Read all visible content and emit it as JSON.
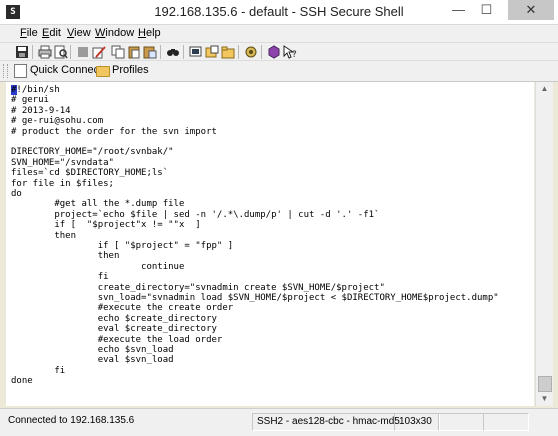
{
  "window": {
    "title": "192.168.135.6 - default - SSH Secure Shell",
    "app_icon_text": "S",
    "minimize_glyph": "—",
    "maximize_glyph": "☐",
    "close_glyph": "✕"
  },
  "menu": {
    "items": [
      {
        "underline": "F",
        "rest": "ile"
      },
      {
        "underline": "E",
        "rest": "dit"
      },
      {
        "underline": "V",
        "rest": "iew"
      },
      {
        "underline": "W",
        "rest": "indow"
      },
      {
        "underline": "H",
        "rest": "elp"
      }
    ]
  },
  "toolbar": {
    "buttons": [
      "save-icon",
      "print-icon",
      "print-preview-icon",
      "blank-icon",
      "settings-icon",
      "copy-icon",
      "paste-icon",
      "paste-special-icon",
      "find-icon",
      "new-terminal-icon",
      "new-file-transfer-icon",
      "profiles-icon",
      "sftp-icon",
      "help-icon"
    ]
  },
  "linkbar": {
    "quick_connect": "Quick Connect",
    "profiles": "Profiles"
  },
  "terminal": {
    "lines": [
      "#!/bin/sh",
      "# gerui",
      "# 2013-9-14",
      "# ge-rui@sohu.com",
      "# product the order for the svn import",
      "",
      "DIRECTORY_HOME=\"/root/svnbak/\"",
      "SVN_HOME=\"/svndata\"",
      "files=`cd $DIRECTORY_HOME;ls`",
      "for file in $files;",
      "do",
      "        #get all the *.dump file",
      "        project=`echo $file | sed -n '/.*\\.dump/p' | cut -d '.' -f1`",
      "        if [  \"$project\"x != \"\"x  ]",
      "        then",
      "                if [ \"$project\" = \"fpp\" ]",
      "                then",
      "                        continue",
      "                fi",
      "                create_directory=\"svnadmin create $SVN_HOME/$project\"",
      "                svn_load=\"svnadmin load $SVN_HOME/$project < $DIRECTORY_HOME$project.dump\"",
      "                #execute the create order",
      "                echo $create_directory",
      "                eval $create_directory",
      "                #execute the load order",
      "                echo $svn_load",
      "                eval $svn_load",
      "        fi",
      "done"
    ]
  },
  "scrollbar": {
    "up_glyph": "▲",
    "down_glyph": "▼"
  },
  "statusbar": {
    "connection": "Connected to 192.168.135.6",
    "cipher": "SSH2 - aes128-cbc - hmac-md5",
    "size": "103x30"
  }
}
